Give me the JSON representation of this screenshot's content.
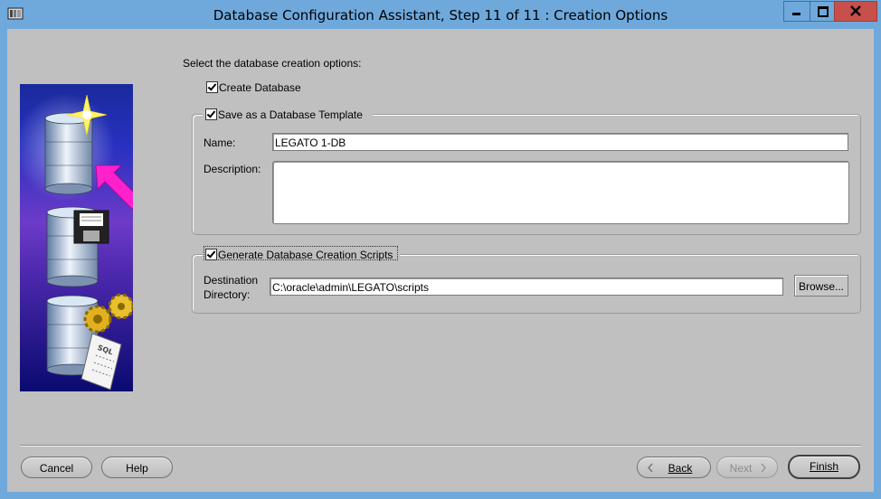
{
  "window": {
    "title": "Database Configuration Assistant, Step 11 of 11 : Creation Options"
  },
  "main": {
    "intro": "Select the database creation options:",
    "create_database": {
      "label": "Create Database",
      "checked": true
    },
    "template_group": {
      "legend": "Save as a Database Template",
      "checked": true,
      "name_label": "Name:",
      "name_value": "LEGATO 1-DB",
      "description_label": "Description:",
      "description_value": ""
    },
    "scripts_group": {
      "legend": "Generate Database Creation Scripts",
      "checked": true,
      "dest_label_1": "Destination",
      "dest_label_2": "Directory:",
      "dest_value": "C:\\oracle\\admin\\LEGATO\\scripts",
      "browse_label": "Browse..."
    }
  },
  "buttons": {
    "cancel": "Cancel",
    "help": "Help",
    "back": "Back",
    "next": "Next",
    "finish": "Finish"
  },
  "side_image": {
    "icons": [
      "database-sparkle-icon",
      "pointer-arrow-icon",
      "database-save-icon",
      "floppy-disk-icon",
      "database-script-icon",
      "gears-icon",
      "sql-scroll-icon"
    ],
    "sql_text": "SQL",
    "colors": {
      "top": "#1a2a9c",
      "bottom": "#0a0a70",
      "arrow": "#ff22cc",
      "gear": "#e0b020"
    }
  },
  "colors": {
    "titlebar": "#6fa9dc",
    "close_button": "#c7504a",
    "dialog_bg": "#c0c0c0"
  }
}
